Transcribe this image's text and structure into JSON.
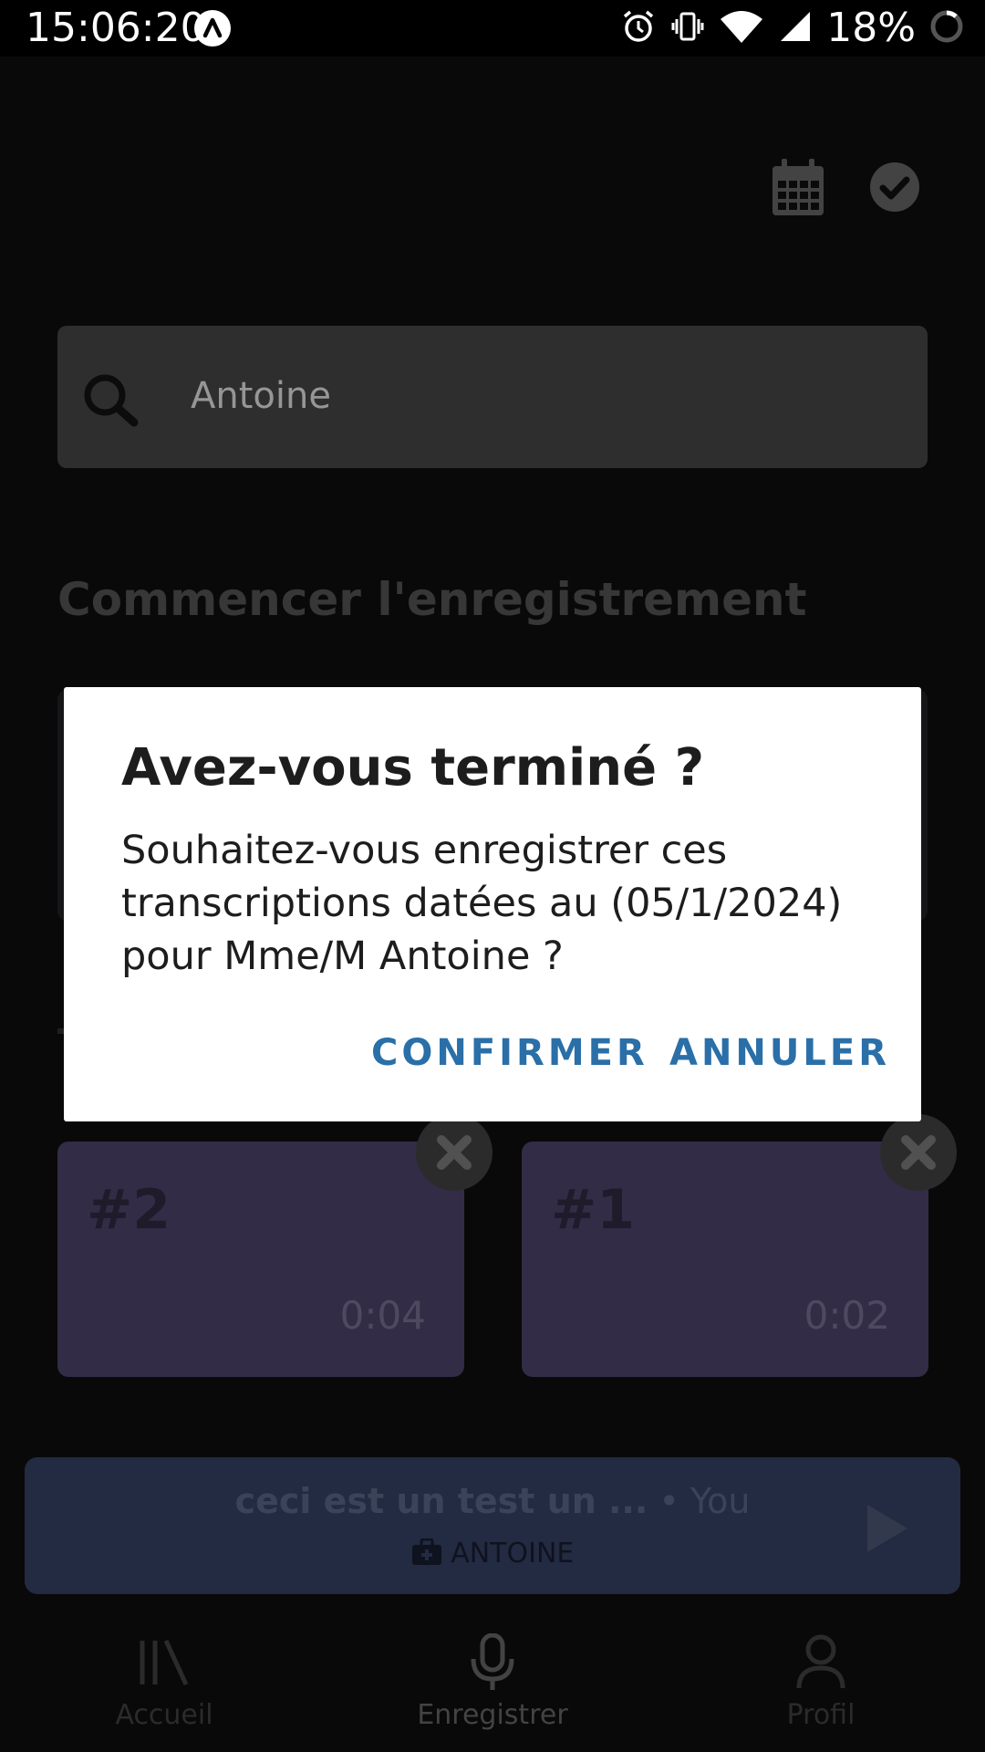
{
  "status_bar": {
    "time": "15:06:20",
    "battery": "18%",
    "icons": [
      "alarm-icon",
      "vibrate-icon",
      "wifi-icon",
      "signal-icon",
      "battery-icon"
    ]
  },
  "search": {
    "value": "Antoine"
  },
  "section": {
    "title": "Commencer l'enregistrement"
  },
  "recordings": [
    {
      "label": "#2",
      "duration": "0:04"
    },
    {
      "label": "#1",
      "duration": "0:02"
    }
  ],
  "player": {
    "title": "ceci est un test un ...",
    "separator": "•",
    "author": "You",
    "patient": "ANTOINE"
  },
  "nav": {
    "items": [
      {
        "label": "Accueil"
      },
      {
        "label": "Enregistrer"
      },
      {
        "label": "Profil"
      }
    ]
  },
  "dialog": {
    "title": "Avez-vous terminé ?",
    "message": "Souhaitez-vous enregistrer ces transcriptions datées au (05/1/2024) pour Mme/M Antoine  ?",
    "confirm": "CONFIRMER",
    "cancel": "ANNULER"
  },
  "colors": {
    "accent": "#2a6fa8",
    "card": "#433b5e",
    "player": "#2f3a59"
  }
}
